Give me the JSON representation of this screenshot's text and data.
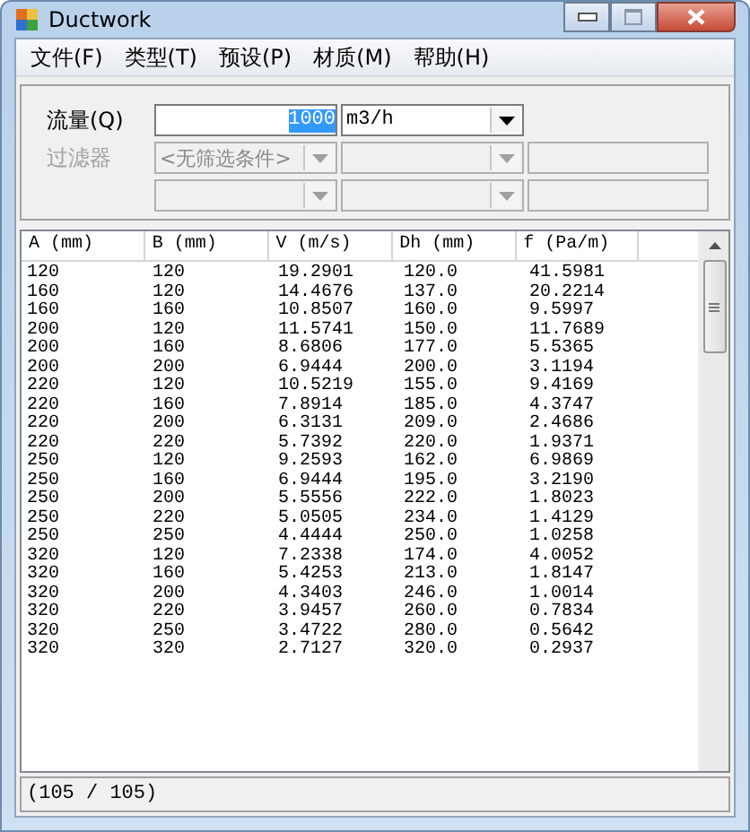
{
  "window": {
    "title": "Ductwork"
  },
  "menu": [
    {
      "label": "文件(F)"
    },
    {
      "label": "类型(T)"
    },
    {
      "label": "预设(P)"
    },
    {
      "label": "材质(M)"
    },
    {
      "label": "帮助(H)"
    }
  ],
  "flow": {
    "label": "流量(Q)",
    "value": "1000",
    "value_selected": true,
    "unit": "m3/h"
  },
  "filter": {
    "label": "过滤器",
    "disabled": true,
    "rows": [
      [
        {
          "kind": "combo",
          "value": "<无筛选条件>",
          "disabled": true
        },
        {
          "kind": "combo",
          "disabled": true
        },
        {
          "kind": "text",
          "disabled": true
        }
      ],
      [
        {
          "kind": "combo",
          "disabled": true
        },
        {
          "kind": "combo",
          "disabled": true
        },
        {
          "kind": "text",
          "disabled": true
        }
      ]
    ]
  },
  "table": {
    "columns": [
      "A (mm)",
      "B (mm)",
      "V (m/s)",
      "Dh (mm)",
      "f (Pa/m)"
    ],
    "rows": [
      [
        "120",
        "120",
        "19.2901",
        "120.0",
        "41.5981"
      ],
      [
        "160",
        "120",
        "14.4676",
        "137.0",
        "20.2214"
      ],
      [
        "160",
        "160",
        "10.8507",
        "160.0",
        "9.5997"
      ],
      [
        "200",
        "120",
        "11.5741",
        "150.0",
        "11.7689"
      ],
      [
        "200",
        "160",
        "8.6806",
        "177.0",
        "5.5365"
      ],
      [
        "200",
        "200",
        "6.9444",
        "200.0",
        "3.1194"
      ],
      [
        "220",
        "120",
        "10.5219",
        "155.0",
        "9.4169"
      ],
      [
        "220",
        "160",
        "7.8914",
        "185.0",
        "4.3747"
      ],
      [
        "220",
        "200",
        "6.3131",
        "209.0",
        "2.4686"
      ],
      [
        "220",
        "220",
        "5.7392",
        "220.0",
        "1.9371"
      ],
      [
        "250",
        "120",
        "9.2593",
        "162.0",
        "6.9869"
      ],
      [
        "250",
        "160",
        "6.9444",
        "195.0",
        "3.2190"
      ],
      [
        "250",
        "200",
        "5.5556",
        "222.0",
        "1.8023"
      ],
      [
        "250",
        "220",
        "5.0505",
        "234.0",
        "1.4129"
      ],
      [
        "250",
        "250",
        "4.4444",
        "250.0",
        "1.0258"
      ],
      [
        "320",
        "120",
        "7.2338",
        "174.0",
        "4.0052"
      ],
      [
        "320",
        "160",
        "5.4253",
        "213.0",
        "1.8147"
      ],
      [
        "320",
        "200",
        "4.3403",
        "246.0",
        "1.0014"
      ],
      [
        "320",
        "220",
        "3.9457",
        "260.0",
        "0.7834"
      ],
      [
        "320",
        "250",
        "3.4722",
        "280.0",
        "0.5642"
      ],
      [
        "320",
        "320",
        "2.7127",
        "320.0",
        "0.2937"
      ]
    ]
  },
  "status_bar": "(105 / 105)"
}
